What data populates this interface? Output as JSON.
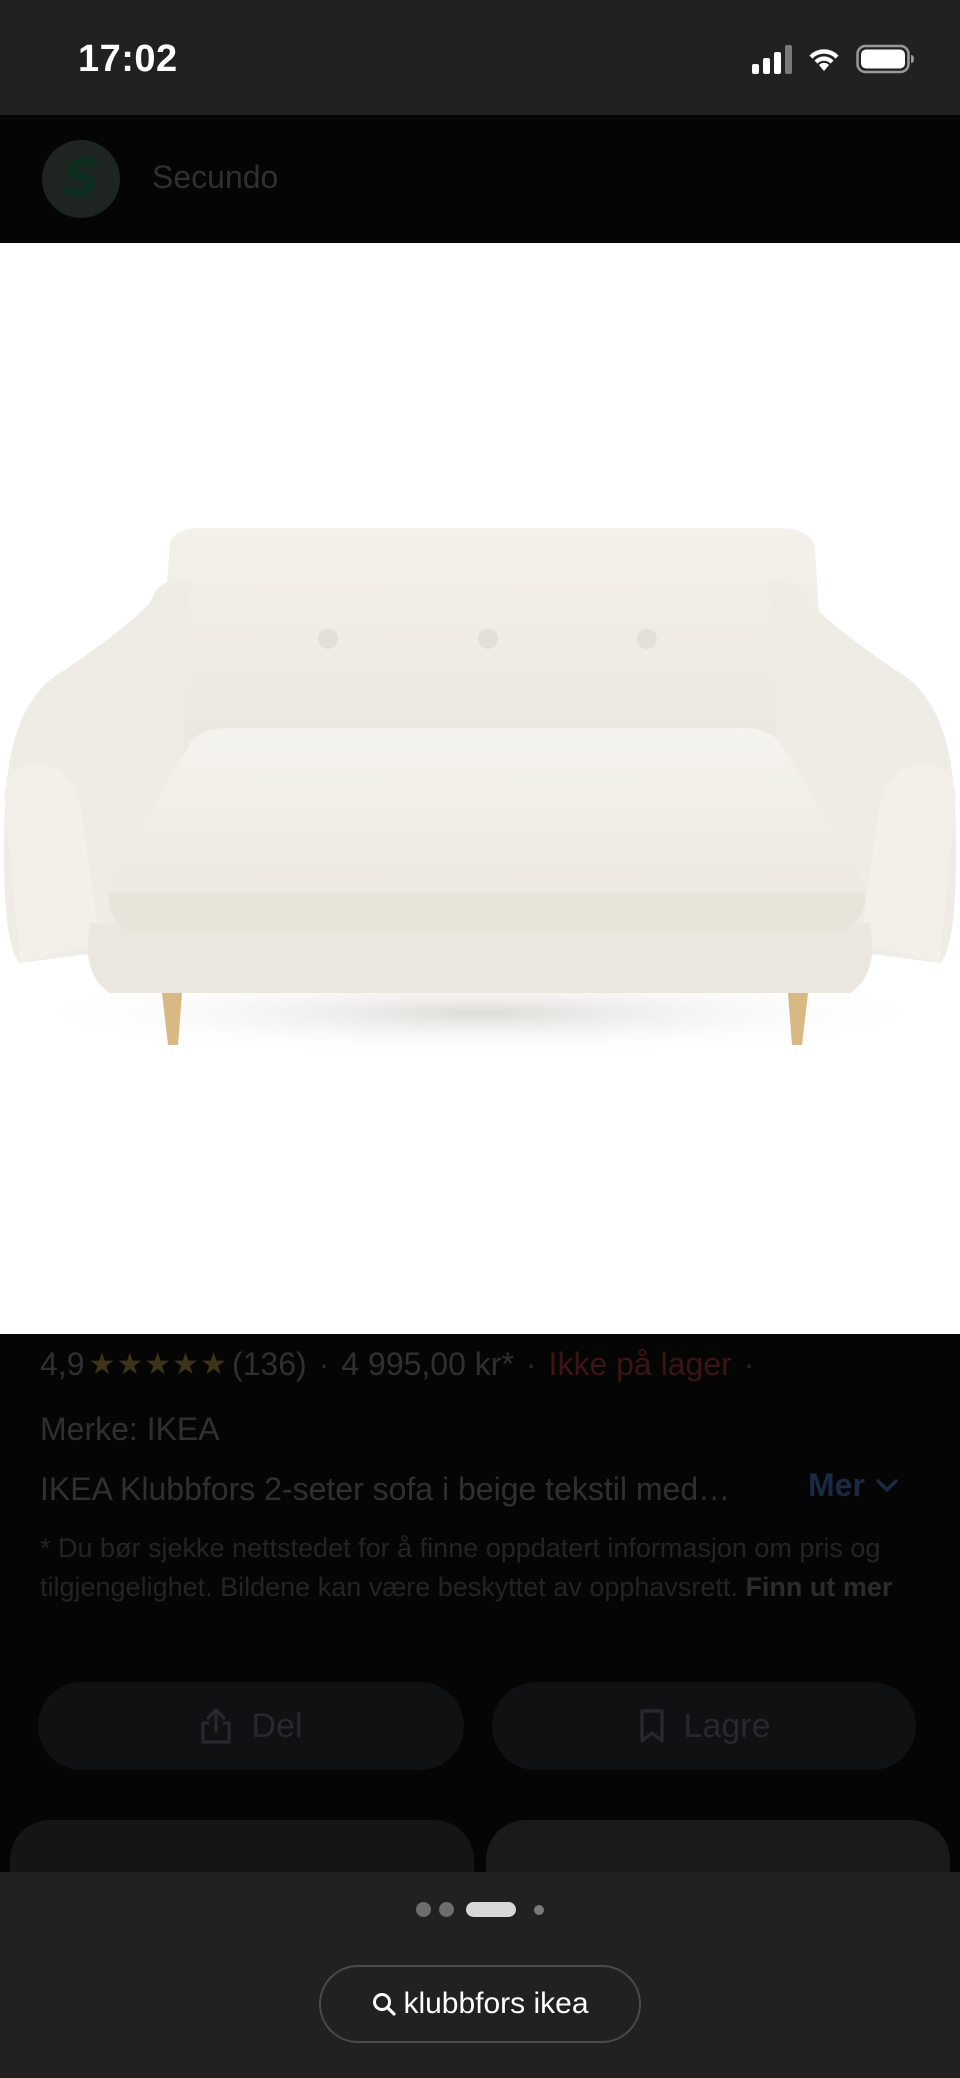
{
  "status_bar": {
    "time": "17:02"
  },
  "source": {
    "logo_letter": "S",
    "name": "Secundo"
  },
  "product": {
    "rating": "4,9",
    "stars": "★★★★★",
    "review_count": "(136)",
    "price": "4 995,00 kr*",
    "stock_status": "Ikke på lager",
    "brand": "Merke: IKEA",
    "description": "IKEA Klubbfors 2-seter sofa i beige tekstil med…",
    "more_label": "Mer",
    "disclaimer": "* Du bør sjekke nettstedet for å finne oppdatert informasjon om pris og tilgjengelighet. Bildene kan være beskyttet av opphavsrett.",
    "learn_more": "Finn ut mer"
  },
  "actions": {
    "share_label": "Del",
    "save_label": "Lagre"
  },
  "bottom": {
    "query": "klubbfors ikea"
  },
  "colors": {
    "accent_link": "#1a2944",
    "stock_red": "#3b1513",
    "bar_bg": "#212121"
  }
}
